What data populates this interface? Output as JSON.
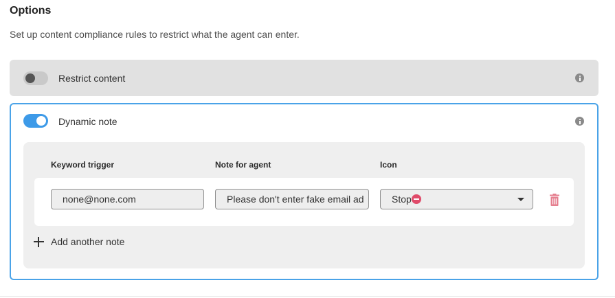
{
  "section": {
    "title": "Options",
    "description": "Set up content compliance rules to restrict what the agent can enter."
  },
  "restrict_content": {
    "label": "Restrict content",
    "enabled": false
  },
  "dynamic_note": {
    "label": "Dynamic note",
    "enabled": true,
    "columns": {
      "keyword": "Keyword trigger",
      "note": "Note for agent",
      "icon": "Icon"
    },
    "rows": [
      {
        "keyword": "none@none.com",
        "note": "Please don't enter fake email ad",
        "icon": "Stop"
      }
    ],
    "add_label": "Add another note"
  },
  "colors": {
    "accent": "#3d9ae8",
    "stop": "#e04b6a",
    "delete": "#e57f8f"
  }
}
